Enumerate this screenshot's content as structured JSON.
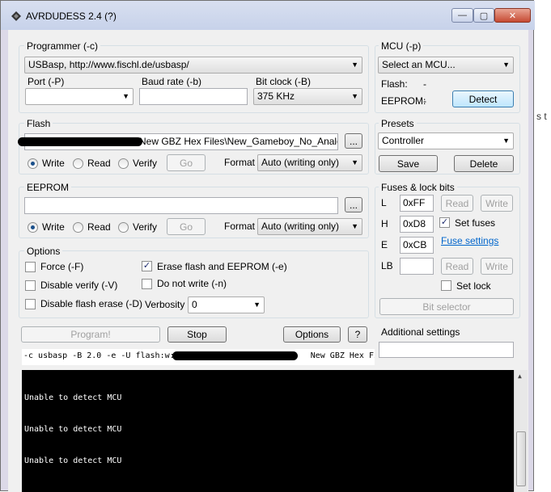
{
  "window": {
    "title": "AVRDUDESS 2.4 (?)",
    "minimize": "—",
    "maximize": "▢",
    "close": "✕"
  },
  "background": {
    "left_fragment": "",
    "right_fragment": "s t"
  },
  "programmer": {
    "group_label": "Programmer (-c)",
    "selected": "USBasp, http://www.fischl.de/usbasp/",
    "port_label": "Port (-P)",
    "port_value": "",
    "baud_label": "Baud rate (-b)",
    "baud_value": "",
    "bitclock_label": "Bit clock (-B)",
    "bitclock_value": "375 KHz"
  },
  "mcu": {
    "group_label": "MCU (-p)",
    "selected": "Select an MCU...",
    "flash_label": "Flash:",
    "flash_value": "-",
    "eeprom_label": "EEPROM:",
    "eeprom_value": "-",
    "detect_label": "Detect"
  },
  "flash": {
    "group_label": "Flash",
    "path_visible": "New GBZ Hex Files\\New_Gameboy_No_Analog_Bu",
    "browse_label": "...",
    "write_label": "Write",
    "read_label": "Read",
    "verify_label": "Verify",
    "go_label": "Go",
    "format_label": "Format",
    "format_value": "Auto (writing only)"
  },
  "eeprom": {
    "group_label": "EEPROM",
    "path_value": "",
    "browse_label": "...",
    "write_label": "Write",
    "read_label": "Read",
    "verify_label": "Verify",
    "go_label": "Go",
    "format_label": "Format",
    "format_value": "Auto (writing only)"
  },
  "options": {
    "group_label": "Options",
    "force_label": "Force (-F)",
    "disable_verify_label": "Disable verify (-V)",
    "disable_flash_erase_label": "Disable flash erase (-D)",
    "erase_label": "Erase flash and EEPROM (-e)",
    "do_not_write_label": "Do not write (-n)",
    "verbosity_label": "Verbosity",
    "verbosity_value": "0",
    "check_mark": "✓"
  },
  "presets": {
    "group_label": "Presets",
    "selected": "Controller",
    "save_label": "Save",
    "delete_label": "Delete"
  },
  "fuses": {
    "group_label": "Fuses & lock bits",
    "l_label": "L",
    "l_value": "0xFF",
    "h_label": "H",
    "h_value": "0xD8",
    "e_label": "E",
    "e_value": "0xCB",
    "lb_label": "LB",
    "lb_value": "",
    "read_label": "Read",
    "write_label": "Write",
    "set_fuses_label": "Set fuses",
    "fuse_settings_link": "Fuse settings",
    "set_lock_label": "Set lock",
    "bit_selector_label": "Bit selector"
  },
  "actions": {
    "program_label": "Program!",
    "stop_label": "Stop",
    "options_label": "Options",
    "help_label": "?"
  },
  "additional": {
    "label": "Additional settings",
    "value": ""
  },
  "command_line": {
    "prefix": "-c usbasp -B 2.0 -e -U flash:w:\"",
    "suffix": "New GBZ Hex Fi"
  },
  "console": {
    "lines": [
      "Unable to detect MCU",
      "Unable to detect MCU",
      "Unable to detect MCU"
    ]
  },
  "icons": {
    "dropdown": "▼",
    "scroll_up": "▲",
    "scroll_down": "▼"
  }
}
